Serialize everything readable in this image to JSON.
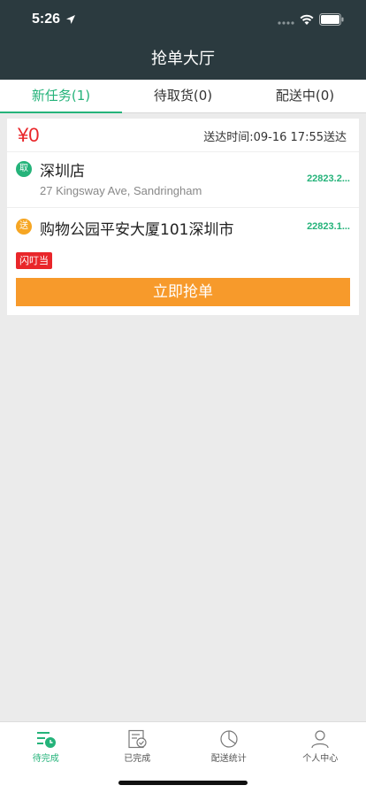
{
  "status_bar": {
    "time": "5:26"
  },
  "nav": {
    "title": "抢单大厅"
  },
  "tabs": [
    {
      "label": "新任务(1)",
      "active": true
    },
    {
      "label": "待取货(0)",
      "active": false
    },
    {
      "label": "配送中(0)",
      "active": false
    }
  ],
  "order": {
    "price": "¥0",
    "deliver_time": "送达时间:09-16 17:55送达",
    "pickup": {
      "badge": "取",
      "name": "深圳店",
      "address": "27 Kingsway Ave, Sandringham",
      "distance": "22823.2..."
    },
    "delivery": {
      "badge": "送",
      "address": "购物公园平安大厦101深圳市",
      "distance": "22823.1..."
    },
    "tag": "闪叮当",
    "grab_button": "立即抢单"
  },
  "tabbar": [
    {
      "label": "待完成",
      "icon": "pending-list-icon",
      "active": true
    },
    {
      "label": "已完成",
      "icon": "completed-doc-icon",
      "active": false
    },
    {
      "label": "配送统计",
      "icon": "pie-chart-icon",
      "active": false
    },
    {
      "label": "个人中心",
      "icon": "person-icon",
      "active": false
    }
  ],
  "colors": {
    "header_bg": "#2b3a3f",
    "accent_green": "#25b37a",
    "price_red": "#e9262a",
    "button_orange": "#f79a2b"
  }
}
